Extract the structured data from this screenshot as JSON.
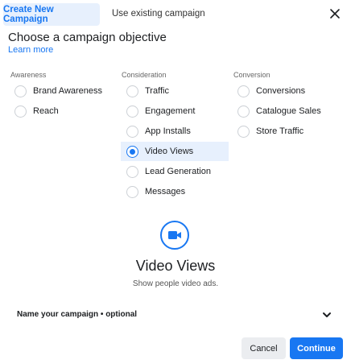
{
  "tabs": {
    "active": "Create New Campaign",
    "inactive": "Use existing campaign"
  },
  "heading": "Choose a campaign objective",
  "learn_more": "Learn more",
  "columns": [
    {
      "title": "Awareness",
      "options": [
        "Brand Awareness",
        "Reach"
      ]
    },
    {
      "title": "Consideration",
      "options": [
        "Traffic",
        "Engagement",
        "App Installs",
        "Video Views",
        "Lead Generation",
        "Messages"
      ]
    },
    {
      "title": "Conversion",
      "options": [
        "Conversions",
        "Catalogue Sales",
        "Store Traffic"
      ]
    }
  ],
  "selected": {
    "column": 1,
    "index": 3,
    "title": "Video Views",
    "description": "Show people video ads."
  },
  "name_campaign": "Name your campaign • optional",
  "buttons": {
    "cancel": "Cancel",
    "continue": "Continue"
  },
  "colors": {
    "accent": "#1877f2",
    "selected_bg": "#e7f0fd"
  },
  "icons": {
    "close": "close-icon",
    "video": "video-camera-icon",
    "chevron": "chevron-down-icon"
  }
}
